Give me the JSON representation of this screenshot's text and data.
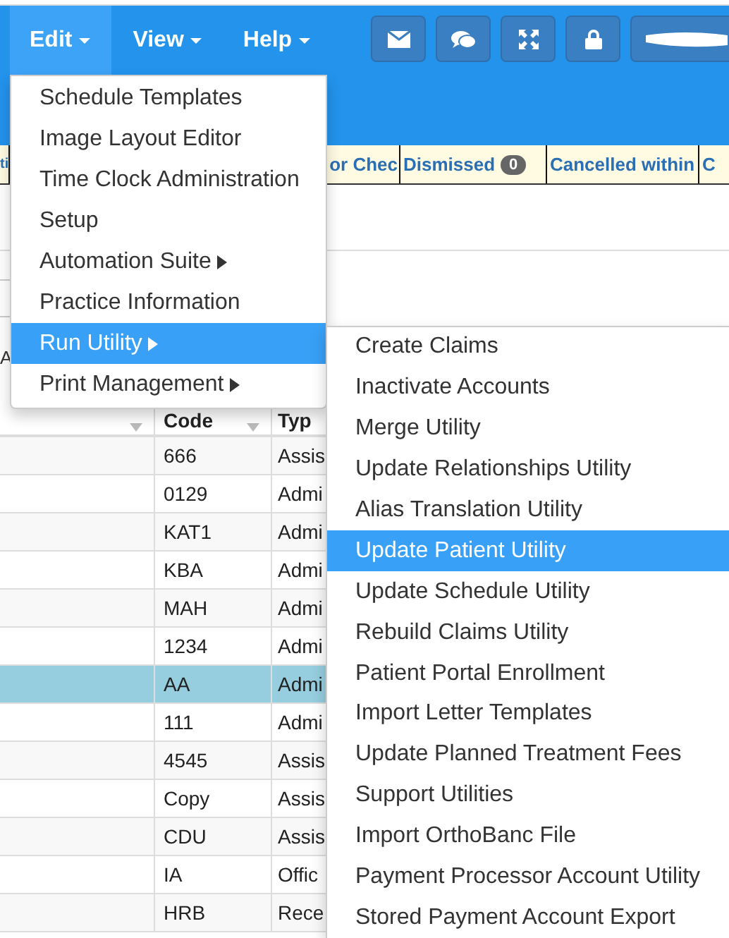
{
  "navbar": {
    "menus": [
      {
        "label": "Edit",
        "open": true
      },
      {
        "label": "View",
        "open": false
      },
      {
        "label": "Help",
        "open": false
      }
    ],
    "toolbar_buttons": [
      {
        "kind": "mail"
      },
      {
        "kind": "chat"
      },
      {
        "kind": "expand"
      },
      {
        "kind": "lock"
      },
      {
        "kind": "user"
      }
    ]
  },
  "status_tabs": [
    {
      "label": "ti"
    },
    {
      "label": "or Chec"
    },
    {
      "label": "Dismissed",
      "count": "0"
    },
    {
      "label": "Cancelled within"
    },
    {
      "label": "C"
    }
  ],
  "side_label": "A",
  "table": {
    "columns": [
      "Code",
      "Typ"
    ],
    "rows": [
      {
        "cells": [
          "666",
          "Assis"
        ],
        "selected": false
      },
      {
        "cells": [
          "0129",
          "Admi"
        ],
        "selected": false
      },
      {
        "cells": [
          "KAT1",
          "Admi"
        ],
        "selected": false
      },
      {
        "cells": [
          "KBA",
          "Admi"
        ],
        "selected": false
      },
      {
        "cells": [
          "MAH",
          "Admi"
        ],
        "selected": false
      },
      {
        "cells": [
          "1234",
          "Admi"
        ],
        "selected": false
      },
      {
        "cells": [
          "AA",
          "Admi"
        ],
        "selected": true
      },
      {
        "cells": [
          "111",
          "Admi"
        ],
        "selected": false
      },
      {
        "cells": [
          "4545",
          "Assis"
        ],
        "selected": false
      },
      {
        "cells": [
          "Copy",
          "Assis"
        ],
        "selected": false
      },
      {
        "cells": [
          "CDU",
          "Assis"
        ],
        "selected": false
      },
      {
        "cells": [
          "IA",
          "Offic"
        ],
        "selected": false
      },
      {
        "cells": [
          "HRB",
          "Rece"
        ],
        "selected": false
      }
    ]
  },
  "edit_menu": {
    "items": [
      {
        "label": "Schedule Templates",
        "has_submenu": false,
        "selected": false
      },
      {
        "label": "Image Layout Editor",
        "has_submenu": false,
        "selected": false
      },
      {
        "label": "Time Clock Administration",
        "has_submenu": false,
        "selected": false
      },
      {
        "label": "Setup",
        "has_submenu": false,
        "selected": false
      },
      {
        "label": "Automation Suite",
        "has_submenu": true,
        "selected": false
      },
      {
        "label": "Practice Information",
        "has_submenu": false,
        "selected": false
      },
      {
        "label": "Run Utility",
        "has_submenu": true,
        "selected": true
      },
      {
        "label": "Print Management",
        "has_submenu": true,
        "selected": false
      }
    ]
  },
  "run_utility_menu": {
    "items": [
      {
        "label": "Create Claims",
        "selected": false
      },
      {
        "label": "Inactivate Accounts",
        "selected": false
      },
      {
        "label": "Merge Utility",
        "selected": false
      },
      {
        "label": "Update Relationships Utility",
        "selected": false
      },
      {
        "label": "Alias Translation Utility",
        "selected": false
      },
      {
        "label": "Update Patient Utility",
        "selected": true
      },
      {
        "label": "Update Schedule Utility",
        "selected": false
      },
      {
        "label": "Rebuild Claims Utility",
        "selected": false
      },
      {
        "label": "Patient Portal Enrollment",
        "selected": false
      },
      {
        "label": "Import Letter Templates",
        "selected": false
      },
      {
        "label": "Update Planned Treatment Fees",
        "selected": false
      },
      {
        "label": "Support Utilities",
        "selected": false
      },
      {
        "label": "Import OrthoBanc File",
        "selected": false
      },
      {
        "label": "Payment Processor Account Utility",
        "selected": false
      },
      {
        "label": "Stored Payment Account Export",
        "selected": false
      }
    ]
  }
}
